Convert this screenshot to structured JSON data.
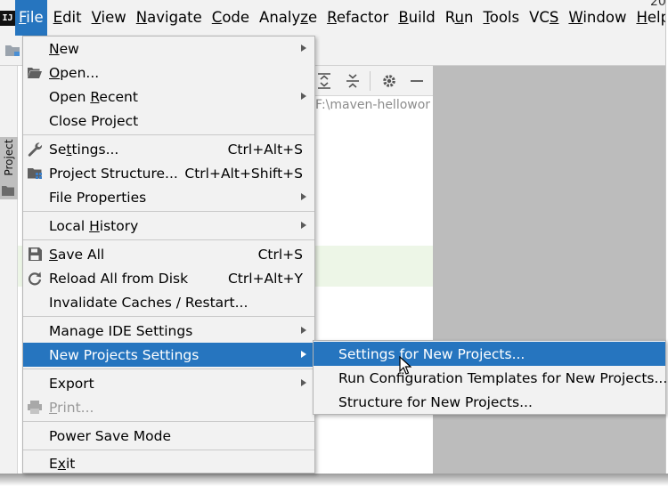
{
  "corner_text": "20",
  "menubar": {
    "items": [
      {
        "pre": "",
        "mn": "F",
        "post": "ile"
      },
      {
        "pre": "",
        "mn": "E",
        "post": "dit"
      },
      {
        "pre": "",
        "mn": "V",
        "post": "iew"
      },
      {
        "pre": "",
        "mn": "N",
        "post": "avigate"
      },
      {
        "pre": "",
        "mn": "C",
        "post": "ode"
      },
      {
        "pre": "Analy",
        "mn": "z",
        "post": "e"
      },
      {
        "pre": "",
        "mn": "R",
        "post": "efactor"
      },
      {
        "pre": "",
        "mn": "B",
        "post": "uild"
      },
      {
        "pre": "R",
        "mn": "u",
        "post": "n"
      },
      {
        "pre": "",
        "mn": "T",
        "post": "ools"
      },
      {
        "pre": "VC",
        "mn": "S",
        "post": ""
      },
      {
        "pre": "",
        "mn": "W",
        "post": "indow"
      },
      {
        "pre": "",
        "mn": "H",
        "post": "elp"
      }
    ]
  },
  "side_strip": {
    "label": "Project"
  },
  "project_panel": {
    "path": "F:\\maven-hellowor"
  },
  "file_menu": {
    "items": [
      {
        "pre": "",
        "mn": "N",
        "post": "ew",
        "submenu": true
      },
      {
        "pre": "",
        "mn": "O",
        "post": "pen...",
        "icon": "folder-open-icon"
      },
      {
        "pre": "Open ",
        "mn": "R",
        "post": "ecent",
        "submenu": true
      },
      {
        "pre": "Close Project",
        "mn": "",
        "post": ""
      },
      {
        "pre": "Se",
        "mn": "t",
        "post": "tings...",
        "shortcut": "Ctrl+Alt+S",
        "icon": "wrench-icon"
      },
      {
        "pre": "Project Structure...",
        "mn": "",
        "post": "",
        "shortcut": "Ctrl+Alt+Shift+S",
        "icon": "project-structure-icon"
      },
      {
        "pre": "File Properties",
        "mn": "",
        "post": "",
        "submenu": true
      },
      {
        "pre": "Local ",
        "mn": "H",
        "post": "istory",
        "submenu": true
      },
      {
        "pre": "",
        "mn": "S",
        "post": "ave All",
        "shortcut": "Ctrl+S",
        "icon": "save-icon"
      },
      {
        "pre": "Reload All from Disk",
        "mn": "",
        "post": "",
        "shortcut": "Ctrl+Alt+Y",
        "icon": "reload-icon"
      },
      {
        "pre": "Invalidate Caches / Restart...",
        "mn": "",
        "post": ""
      },
      {
        "pre": "Manage IDE Settings",
        "mn": "",
        "post": "",
        "submenu": true
      },
      {
        "pre": "New Projects Settings",
        "mn": "",
        "post": "",
        "submenu": true,
        "selected": true
      },
      {
        "pre": "Export",
        "mn": "",
        "post": "",
        "submenu": true
      },
      {
        "pre": "",
        "mn": "P",
        "post": "rint...",
        "disabled": true,
        "icon": "print-icon"
      },
      {
        "pre": "Power Save Mode",
        "mn": "",
        "post": ""
      },
      {
        "pre": "E",
        "mn": "x",
        "post": "it"
      }
    ]
  },
  "submenu": {
    "items": [
      {
        "label": "Settings for New Projects...",
        "selected": true
      },
      {
        "label": "Run Configuration Templates for New Projects..."
      },
      {
        "label": "Structure for New Projects..."
      }
    ]
  },
  "colors": {
    "accent": "#2675bf",
    "menu_bg": "#f2f2f2",
    "editor_bg": "#bcbcbc"
  }
}
